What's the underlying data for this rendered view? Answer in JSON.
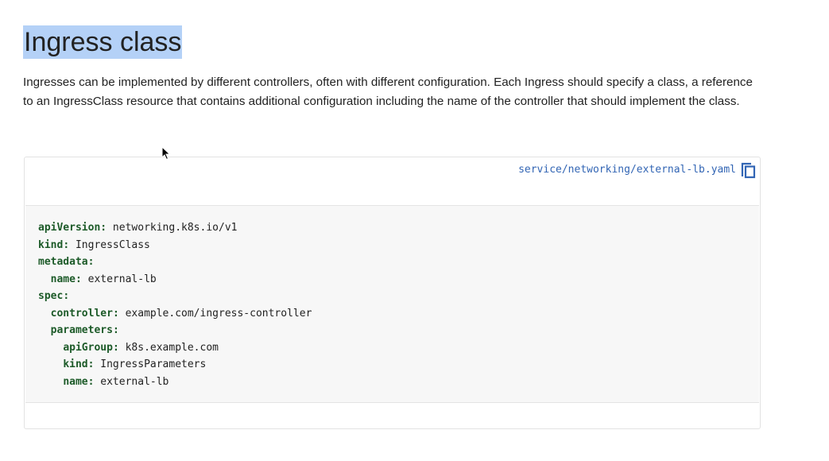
{
  "section": {
    "title": "Ingress class",
    "intro": "Ingresses can be implemented by different controllers, often with different configuration. Each Ingress should specify a class, a reference to an IngressClass resource that contains additional configuration including the name of the controller that should implement the class."
  },
  "code_block": {
    "file_link": "service/networking/external-lb.yaml",
    "copy_icon": "copy-icon",
    "lines": [
      {
        "indent": "",
        "key": "apiVersion",
        "value": " networking.k8s.io/v1"
      },
      {
        "indent": "",
        "key": "kind",
        "value": " IngressClass"
      },
      {
        "indent": "",
        "key": "metadata",
        "value": ""
      },
      {
        "indent": "  ",
        "key": "name",
        "value": " external-lb"
      },
      {
        "indent": "",
        "key": "spec",
        "value": ""
      },
      {
        "indent": "  ",
        "key": "controller",
        "value": " example.com/ingress-controller"
      },
      {
        "indent": "  ",
        "key": "parameters",
        "value": ""
      },
      {
        "indent": "    ",
        "key": "apiGroup",
        "value": " k8s.example.com"
      },
      {
        "indent": "    ",
        "key": "kind",
        "value": " IngressParameters"
      },
      {
        "indent": "    ",
        "key": "name",
        "value": " external-lb"
      }
    ]
  },
  "colors": {
    "link": "#3265b4",
    "yaml_key": "#1c5a28",
    "code_background": "#f7f7f7",
    "title_highlight": "#b4d1f7"
  }
}
